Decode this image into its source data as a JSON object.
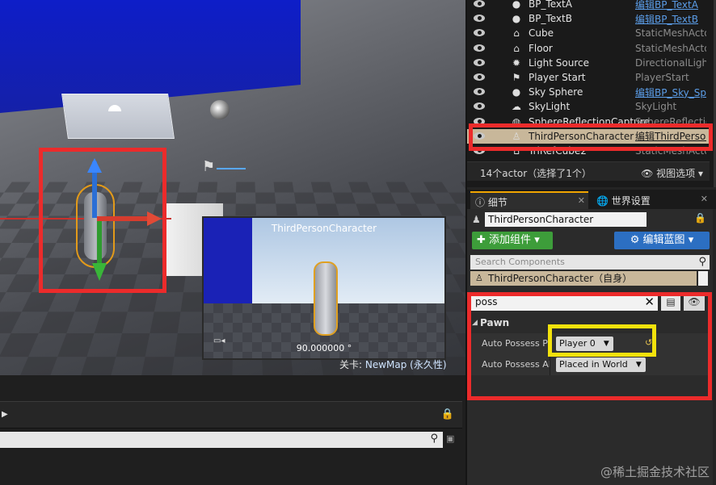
{
  "viewport": {
    "preview_title": "ThirdPersonCharacter",
    "preview_angle": "90.000000 °",
    "level_prefix": "关卡: ",
    "level_name": "NewMap (永久性)"
  },
  "outliner": {
    "rows": [
      {
        "name": "BP_TextA",
        "type": "编辑BP_TextA",
        "icon": "sphere-icon",
        "link": true
      },
      {
        "name": "BP_TextB",
        "type": "编辑BP_TextB",
        "icon": "sphere-icon",
        "link": true
      },
      {
        "name": "Cube",
        "type": "StaticMeshActor",
        "icon": "mesh-icon",
        "link": false
      },
      {
        "name": "Floor",
        "type": "StaticMeshActor",
        "icon": "mesh-icon",
        "link": false
      },
      {
        "name": "Light Source",
        "type": "DirectionalLight",
        "icon": "light-icon",
        "link": false
      },
      {
        "name": "Player Start",
        "type": "PlayerStart",
        "icon": "flag-icon",
        "link": false
      },
      {
        "name": "Sky Sphere",
        "type": "编辑BP_Sky_Sphere",
        "icon": "sphere-icon",
        "link": true
      },
      {
        "name": "SkyLight",
        "type": "SkyLight",
        "icon": "skylight-icon",
        "link": false
      },
      {
        "name": "SphereReflectionCapture",
        "type": "SphereReflectionCapture",
        "icon": "reflection-icon",
        "link": false
      },
      {
        "name": "ThirdPersonCharacter",
        "type": "编辑ThirdPersonCharacter",
        "icon": "pawn-icon",
        "link": true,
        "selected": true
      },
      {
        "name": "TriRefCube2",
        "type": "StaticMeshActor",
        "icon": "mesh-icon",
        "link": false
      }
    ],
    "count_text": "14个actor（选择了1个）",
    "view_options": "视图选项"
  },
  "tabs": {
    "details": "细节",
    "world_settings": "世界设置"
  },
  "details": {
    "actor_name": "ThirdPersonCharacter",
    "add_component": "添加组件",
    "edit_blueprint": "编辑蓝图",
    "component_search_placeholder": "Search Components",
    "root_component": "ThirdPersonCharacter（自身）",
    "filter_value": "poss",
    "category": "Pawn",
    "props": [
      {
        "name": "Auto Possess Player",
        "value": "Player 0"
      },
      {
        "name": "Auto Possess AI",
        "value": "Placed in World"
      }
    ]
  },
  "watermark": "@稀土掘金技术社区",
  "colors": {
    "highlight_red": "#ec2b2b",
    "highlight_yellow": "#f2e20c",
    "add_green": "#3d9d3a",
    "blueprint_blue": "#2c6fc2"
  }
}
